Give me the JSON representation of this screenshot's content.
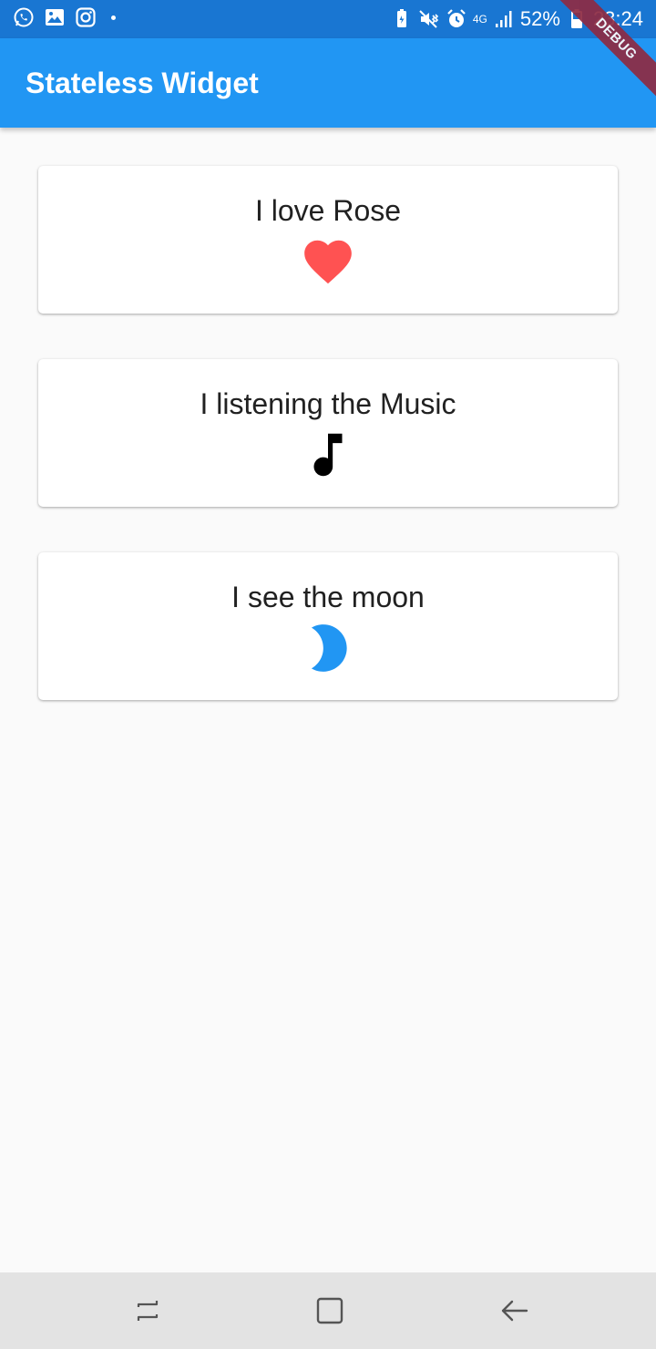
{
  "status_bar": {
    "battery_percent": "52%",
    "network_type": "4G",
    "time": "23:24"
  },
  "app_bar": {
    "title": "Stateless Widget"
  },
  "debug_banner": "DEBUG",
  "cards": [
    {
      "text": "I love Rose",
      "icon": "heart-icon",
      "icon_color": "#ff5252"
    },
    {
      "text": "I listening the Music",
      "icon": "music-note-icon",
      "icon_color": "#000000"
    },
    {
      "text": "I see the moon",
      "icon": "moon-icon",
      "icon_color": "#2196f3"
    }
  ],
  "colors": {
    "status_bar": "#1976d2",
    "app_bar": "#2196f3",
    "background": "#fafafa",
    "nav_bar": "#e3e3e3",
    "debug_ribbon": "#8e2b43"
  }
}
